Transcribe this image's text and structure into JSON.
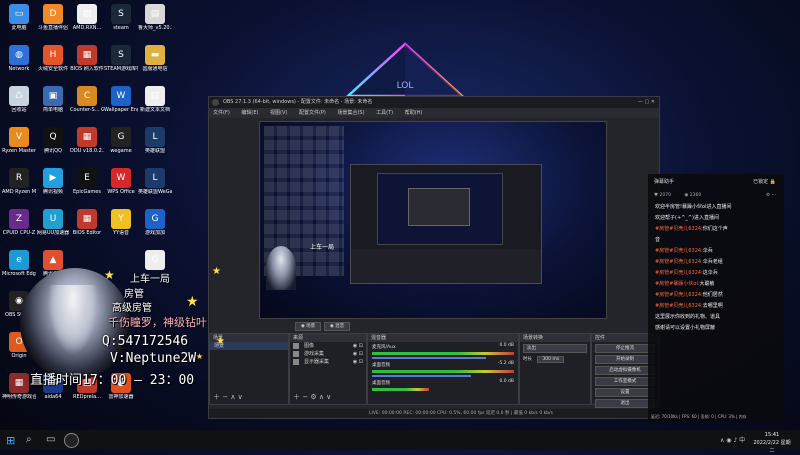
{
  "desktop": {
    "icons": [
      {
        "label": "此电脑",
        "name": "this-pc-icon",
        "color": "#3a8ee6",
        "glyph": "▭"
      },
      {
        "label": "斗鱼直播伴侣",
        "name": "douyu-icon",
        "color": "#f08a24",
        "glyph": "D"
      },
      {
        "label": "AMD.RXN...",
        "name": "document-icon",
        "color": "#eeeeee",
        "glyph": "▤"
      },
      {
        "label": "steam",
        "name": "steam-icon",
        "color": "#1b2838",
        "glyph": "S"
      },
      {
        "label": "鲁大师_v5.20.124...",
        "name": "ludashi-icon",
        "color": "#d8d8d8",
        "glyph": "▤"
      },
      {
        "label": "Network",
        "name": "network-icon",
        "color": "#2e6fd8",
        "glyph": "◍"
      },
      {
        "label": "火绒安全软件",
        "name": "huorong-icon",
        "color": "#e8542a",
        "glyph": "H"
      },
      {
        "label": "BIOS 刷入软件",
        "name": "bios-flash-icon",
        "color": "#c0392b",
        "glyph": "▦"
      },
      {
        "label": "STEAM游戏库存",
        "name": "steam-library-icon",
        "color": "#1b2838",
        "glyph": "S"
      },
      {
        "label": "国服通电信",
        "name": "folder-icon",
        "color": "#e0b040",
        "glyph": "▬"
      },
      {
        "label": "回收站",
        "name": "recycle-bin-icon",
        "color": "#c8d4e0",
        "glyph": "♺"
      },
      {
        "label": "简单电脑",
        "name": "computer-icon",
        "color": "#3a6ab0",
        "glyph": "▣"
      },
      {
        "label": "Counter-S... Global Off...",
        "name": "csgo-icon",
        "color": "#d88a20",
        "glyph": "C"
      },
      {
        "label": "Wallpaper Engine:...",
        "name": "wallpaper-engine-icon",
        "color": "#1c62c8",
        "glyph": "W"
      },
      {
        "label": "新建文本文档",
        "name": "text-document-icon",
        "color": "#eeeeee",
        "glyph": "▤"
      },
      {
        "label": "Ryzen Master",
        "name": "ryzen-icon",
        "color": "#e88a20",
        "glyph": "V"
      },
      {
        "label": "腾讯QQ",
        "name": "qq-icon",
        "color": "#111111",
        "glyph": "Q"
      },
      {
        "label": "DDU v18.0.2.2",
        "name": "ddu-icon",
        "color": "#c0392b",
        "glyph": "▦"
      },
      {
        "label": "wegame",
        "name": "wegame-icon",
        "color": "#222222",
        "glyph": "G"
      },
      {
        "label": "英雄联盟",
        "name": "lol-icon",
        "color": "#1c3a6a",
        "glyph": "L"
      },
      {
        "label": "AMD Ryzen Master",
        "name": "amd-ryzen-icon",
        "color": "#222222",
        "glyph": "R"
      },
      {
        "label": "腾讯视频",
        "name": "tencent-video-icon",
        "color": "#20a0e0",
        "glyph": "▶"
      },
      {
        "label": "EpicGames",
        "name": "epic-games-icon",
        "color": "#111111",
        "glyph": "E"
      },
      {
        "label": "WPS Office",
        "name": "wps-icon",
        "color": "#d8262a",
        "glyph": "W"
      },
      {
        "label": "英雄联盟WeGame版",
        "name": "lol-wegame-icon",
        "color": "#1c3a6a",
        "glyph": "L"
      },
      {
        "label": "CPUID CPU-Z",
        "name": "cpuz-icon",
        "color": "#6a2a8a",
        "glyph": "Z"
      },
      {
        "label": "网易UU加速器",
        "name": "uu-icon",
        "color": "#20a0d0",
        "glyph": "U"
      },
      {
        "label": "BIOS Editor",
        "name": "bios-editor-icon",
        "color": "#c0392b",
        "glyph": "▦"
      },
      {
        "label": "YY语音",
        "name": "yy-icon",
        "color": "#f0c020",
        "glyph": "Y"
      },
      {
        "label": "游戏加加",
        "name": "game-plus-icon",
        "color": "#1c62c8",
        "glyph": "G"
      },
      {
        "label": "Microsoft Edge",
        "name": "edge-icon",
        "color": "#1c9ad8",
        "glyph": "e"
      },
      {
        "label": "腾讯会议",
        "name": "meeting-icon",
        "color": "#e05030",
        "glyph": "▲"
      },
      {
        "label": "",
        "name": "blank-icon",
        "color": "#222222",
        "glyph": ""
      },
      {
        "label": "",
        "name": "blank-icon",
        "color": "#222222",
        "glyph": ""
      },
      {
        "label": "",
        "name": "google-icon",
        "color": "#eeeeee",
        "glyph": "G"
      },
      {
        "label": "OBS Studio",
        "name": "obs-icon",
        "color": "#222222",
        "glyph": "◉"
      },
      {
        "label": "",
        "name": "blank-icon",
        "color": "#222222",
        "glyph": ""
      },
      {
        "label": "",
        "name": "blank-icon",
        "color": "#222222",
        "glyph": ""
      },
      {
        "label": "",
        "name": "blank-icon",
        "color": "#222222",
        "glyph": ""
      },
      {
        "label": "",
        "name": "blank-icon",
        "color": "#222222",
        "glyph": ""
      },
      {
        "label": "Origin",
        "name": "origin-icon",
        "color": "#e05a20",
        "glyph": "O"
      },
      {
        "label": "",
        "name": "blank-icon",
        "color": "#222222",
        "glyph": ""
      },
      {
        "label": "",
        "name": "blank-icon",
        "color": "#222222",
        "glyph": ""
      },
      {
        "label": "",
        "name": "blank-icon",
        "color": "#222222",
        "glyph": ""
      },
      {
        "label": "",
        "name": "blank-icon",
        "color": "#222222",
        "glyph": ""
      },
      {
        "label": "神明传奇游戏合...",
        "name": "legend-icon",
        "color": "#8a2a2a",
        "glyph": "▦"
      },
      {
        "label": "aida64",
        "name": "aida64-icon",
        "color": "#1c3a8a",
        "glyph": "64"
      },
      {
        "label": "REDprela...",
        "name": "red-icon",
        "color": "#c0392b",
        "glyph": "▦"
      },
      {
        "label": "雷神加速器",
        "name": "leishen-icon",
        "color": "#e05020",
        "glyph": "●"
      },
      {
        "label": "",
        "name": "blank-icon",
        "color": "#222222",
        "glyph": ""
      }
    ]
  },
  "pyramid_text": "LOL",
  "obs": {
    "title": "OBS 27.1.3 (64-bit, windows) - 配置文件: 未命名 - 场景: 未命名",
    "menu": [
      "文件(F)",
      "编辑(E)",
      "视图(V)",
      "配置文件(P)",
      "场景集合(S)",
      "工具(T)",
      "帮助(H)"
    ],
    "tabs": [
      "◉ 场景",
      "◉ 混音"
    ],
    "docks": {
      "scenes": "场景",
      "sources": "来源",
      "mixer": "混音器",
      "transitions": "场景转换",
      "controls": "控件"
    },
    "scene_items": [
      "场景"
    ],
    "sources": [
      "图像",
      "游戏采集",
      "显示器采集"
    ],
    "mixer": [
      {
        "name": "麦克风/Aux",
        "db": "0.0 dB"
      },
      {
        "name": "桌面音频",
        "db": "-5.2 dB"
      },
      {
        "name": "桌面音频",
        "db": "0.0 dB"
      }
    ],
    "transition": {
      "type": "淡出",
      "duration_label": "时长",
      "duration": "300 ms"
    },
    "controls": [
      "停止推流",
      "开始录制",
      "启动虚拟摄像机",
      "工作室模式",
      "设置",
      "退出"
    ],
    "status": "LIVE: 00:00:00   REC: 00:00:00   CPU: 0.5%, 60.00 fps   延迟 0.0 秒 | 最低 0 kb/s   0 kb/s"
  },
  "chat": {
    "header": "弹幕助手",
    "header_right": "已锁定",
    "stats": [
      "2070",
      "2360"
    ],
    "lines": [
      {
        "name": "",
        "text": "欢迎半房管!暴躁小伙ol进入直播间"
      },
      {
        "name": "",
        "text": "欢迎帮子(+^_^)进入直播间"
      },
      {
        "name": "#房管#贝壳儿6324:",
        "text": "你们这个声"
      },
      {
        "name": "",
        "text": "音"
      },
      {
        "name": "#房管#贝壳儿6324:",
        "text": "伞兵"
      },
      {
        "name": "#房管#贝壳儿6324:",
        "text": "伞兵老组"
      },
      {
        "name": "#房管#贝壳儿6324:",
        "text": "这伞兵"
      },
      {
        "name": "#房管#暴躁小伙ol:",
        "text": "大聪敏"
      },
      {
        "name": "#房管#贝壳儿6324:",
        "text": "他们居然"
      },
      {
        "name": "#房管#贝壳儿6324:",
        "text": "去哪里啊"
      },
      {
        "name": "",
        "text": "这里展示你收到的礼物、道具"
      },
      {
        "name": "",
        "text": "感谢请可以设置小礼物屏蔽"
      }
    ],
    "footer": "延迟: 70/10Ks | FPS: 60 | 丢帧: 0 | CPU: 3% | 内存"
  },
  "overlay": {
    "line1": "上车一局",
    "line2": "房管",
    "line3": "高级房管",
    "line4": "千伤瞳罗，神级钻叶",
    "qq": "Q:547172546",
    "vx": "V:Neptune2W",
    "schedule": "直播时间17：00 — 23：00"
  },
  "taskbar": {
    "time": "15:41",
    "date": "2022/2/22 星期二"
  },
  "colors": {
    "accent": "#ff6a3a",
    "chat_name": "#ff6a3a",
    "neon_cyan": "#3cf0ff",
    "neon_magenta": "#ff3cff"
  }
}
